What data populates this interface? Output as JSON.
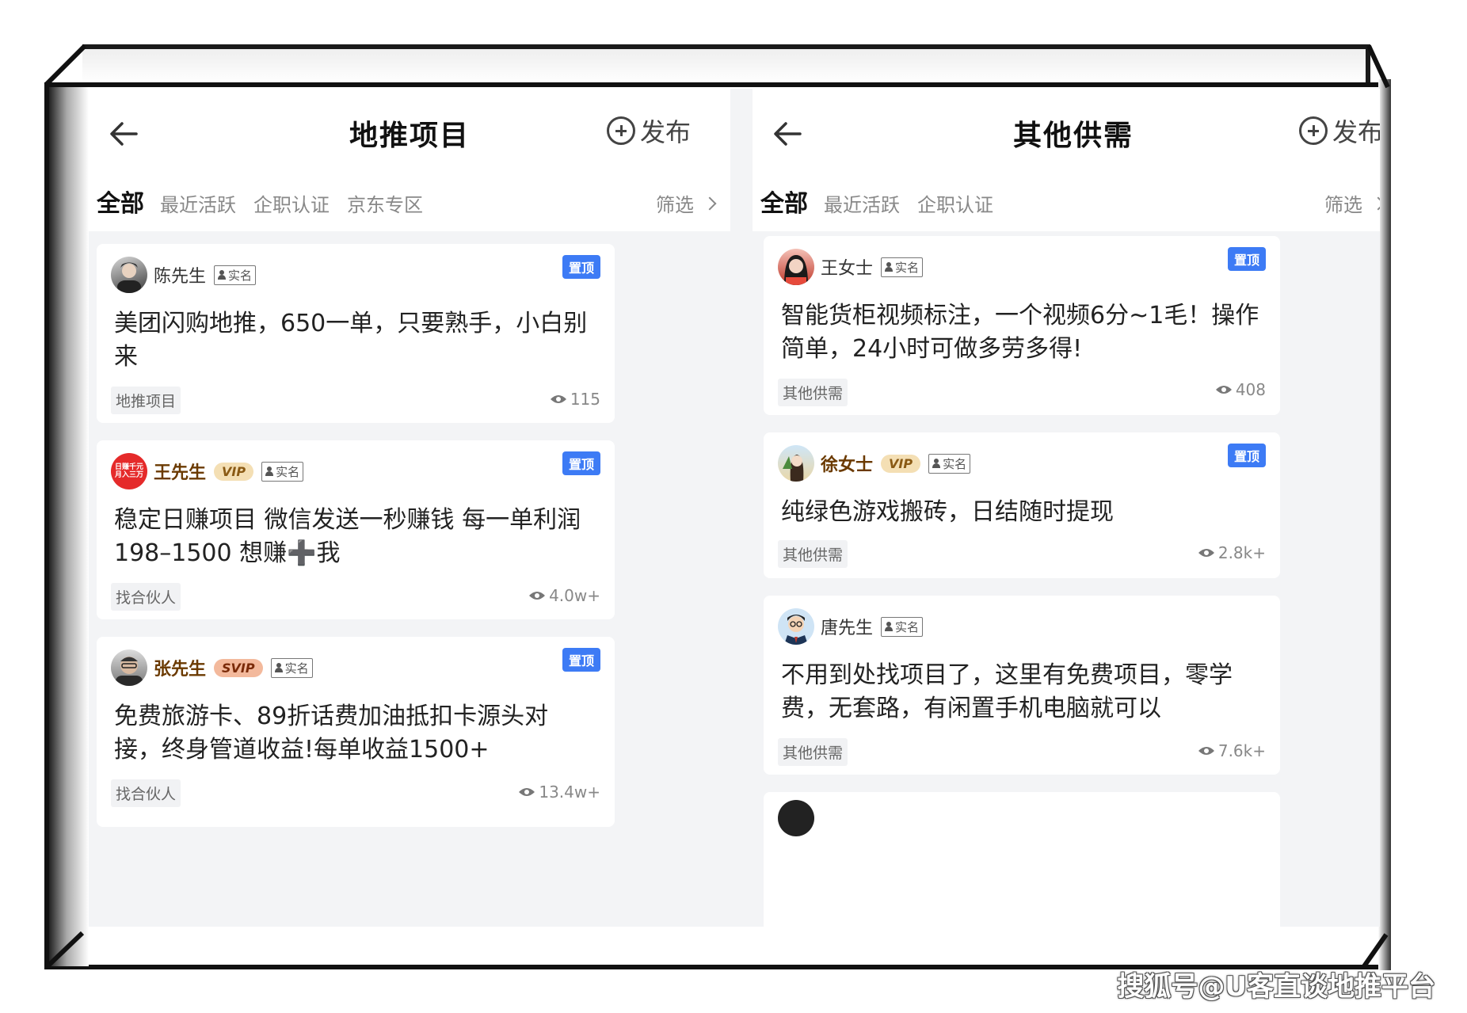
{
  "left_panel": {
    "title": "地推项目",
    "publish_label": "发布",
    "tabs": [
      "全部",
      "最近活跃",
      "企职认证",
      "京东专区"
    ],
    "filter_label": "筛选",
    "posts": [
      {
        "user": "陈先生",
        "real_badge": "实名",
        "pin": "置顶",
        "text": "美团闪购地推，650一单，只要熟手，小白别来",
        "tag": "地推项目",
        "views": "115"
      },
      {
        "user": "王先生",
        "vip": "VIP",
        "real_badge": "实名",
        "pin": "置顶",
        "avatar_text": "日赚千元 月入三万",
        "text": "稳定日赚项目 微信发送一秒赚钱 每一单利润198–1500 想赚➕我",
        "tag": "找合伙人",
        "views": "4.0w+"
      },
      {
        "user": "张先生",
        "vip": "SVIP",
        "real_badge": "实名",
        "pin": "置顶",
        "text": "免费旅游卡、89折话费加油抵扣卡源头对接，终身管道收益!每单收益1500+",
        "tag": "找合伙人",
        "views": "13.4w+"
      }
    ]
  },
  "right_panel": {
    "title": "其他供需",
    "publish_label": "发布",
    "tabs": [
      "全部",
      "最近活跃",
      "企职认证"
    ],
    "filter_label": "筛选",
    "posts": [
      {
        "user": "王女士",
        "real_badge": "实名",
        "pin": "置顶",
        "text": "智能货柜视频标注，一个视频6分~1毛！操作简单，24小时可做多劳多得!",
        "tag": "其他供需",
        "views": "408"
      },
      {
        "user": "徐女士",
        "vip": "VIP",
        "real_badge": "实名",
        "pin": "置顶",
        "text": "纯绿色游戏搬砖，日结随时提现",
        "tag": "其他供需",
        "views": "2.8k+"
      },
      {
        "user": "唐先生",
        "real_badge": "实名",
        "text": "不用到处找项目了，这里有免费项目，零学费，无套路，有闲置手机电脑就可以",
        "tag": "其他供需",
        "views": "7.6k+"
      }
    ]
  },
  "watermark": "搜狐号@U客直谈地推平台",
  "colors": {
    "pin_blue": "#3d7bf5",
    "vip_gold": "#f4dfb4",
    "svip_orange": "#f3b99c",
    "frame": "#111111"
  }
}
